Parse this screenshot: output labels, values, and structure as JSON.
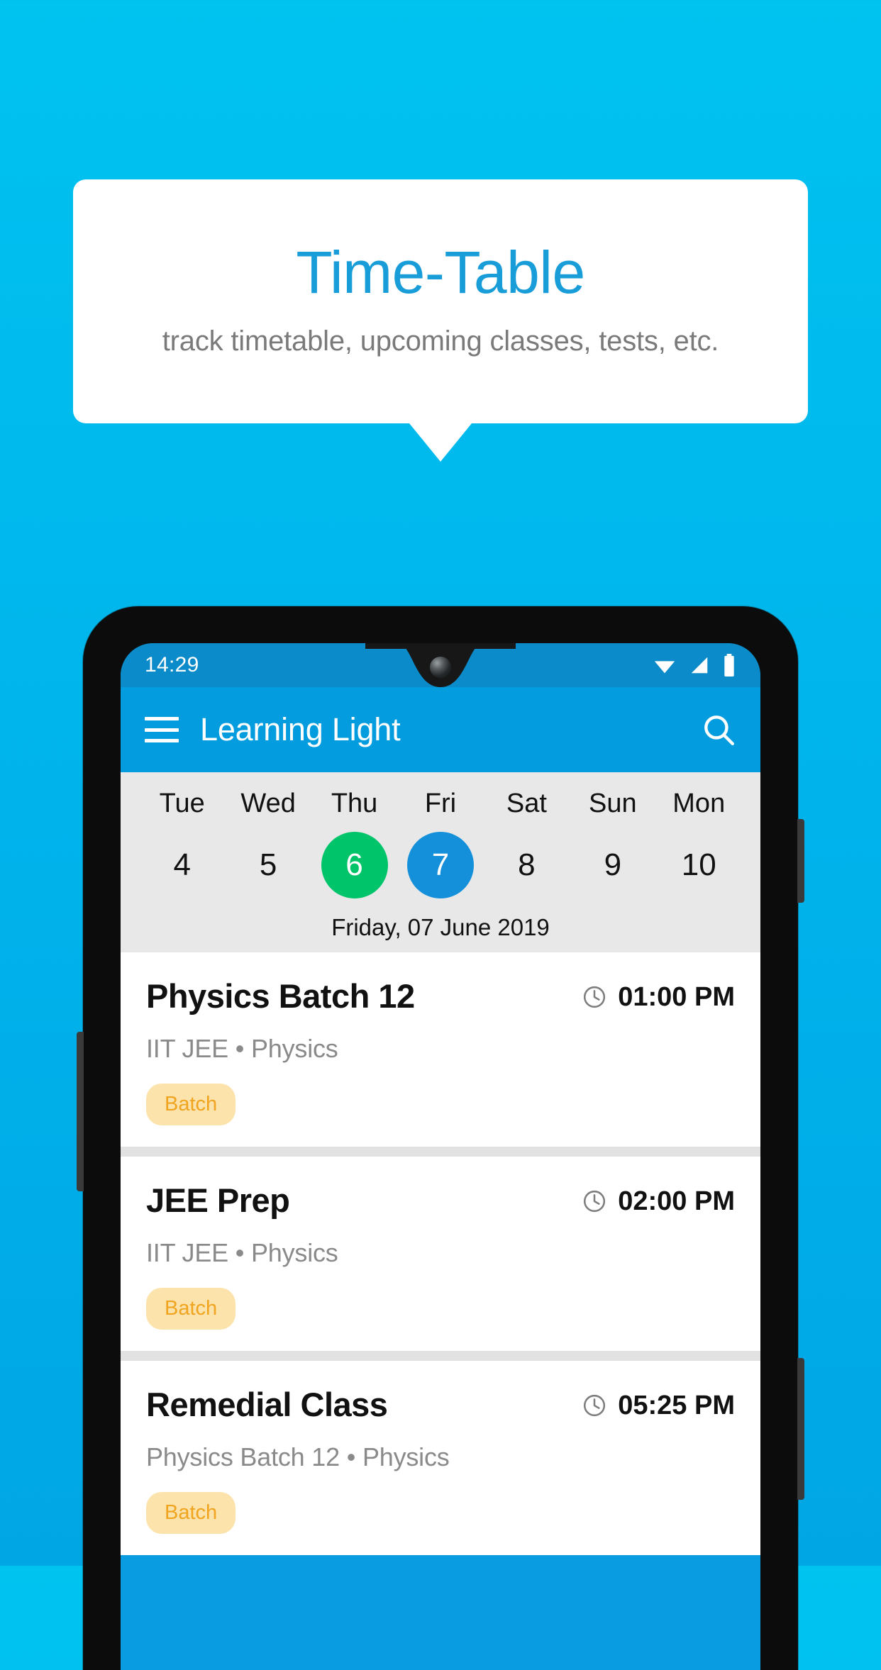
{
  "promo": {
    "title": "Time-Table",
    "subtitle": "track timetable, upcoming classes, tests, etc."
  },
  "colors": {
    "background_top": "#00C3F0",
    "background_bottom": "#00A6E4",
    "title_blue": "#189DD9",
    "appbar_blue": "#039DDF",
    "statusbar_blue": "#0B8BC9",
    "today_green": "#00C46A",
    "selected_blue": "#1490DA",
    "badge_bg": "#FCE3AB",
    "badge_text": "#F0A41F"
  },
  "phone": {
    "statusbar": {
      "time": "14:29",
      "icons": [
        "wifi-icon",
        "signal-icon",
        "battery-icon"
      ]
    },
    "appbar": {
      "menu_icon": "hamburger-menu-icon",
      "title": "Learning Light",
      "search_icon": "search-icon"
    },
    "datestrip": {
      "days": [
        {
          "name": "Tue",
          "num": "4",
          "state": "normal"
        },
        {
          "name": "Wed",
          "num": "5",
          "state": "normal"
        },
        {
          "name": "Thu",
          "num": "6",
          "state": "today"
        },
        {
          "name": "Fri",
          "num": "7",
          "state": "selected"
        },
        {
          "name": "Sat",
          "num": "8",
          "state": "normal"
        },
        {
          "name": "Sun",
          "num": "9",
          "state": "normal"
        },
        {
          "name": "Mon",
          "num": "10",
          "state": "normal"
        }
      ],
      "full_date": "Friday, 07 June 2019"
    },
    "classes": [
      {
        "title": "Physics Batch 12",
        "time": "01:00 PM",
        "subtitle": "IIT JEE • Physics",
        "badge": "Batch"
      },
      {
        "title": "JEE Prep",
        "time": "02:00 PM",
        "subtitle": "IIT JEE • Physics",
        "badge": "Batch"
      },
      {
        "title": "Remedial Class",
        "time": "05:25 PM",
        "subtitle": "Physics Batch 12 • Physics",
        "badge": "Batch"
      }
    ]
  }
}
